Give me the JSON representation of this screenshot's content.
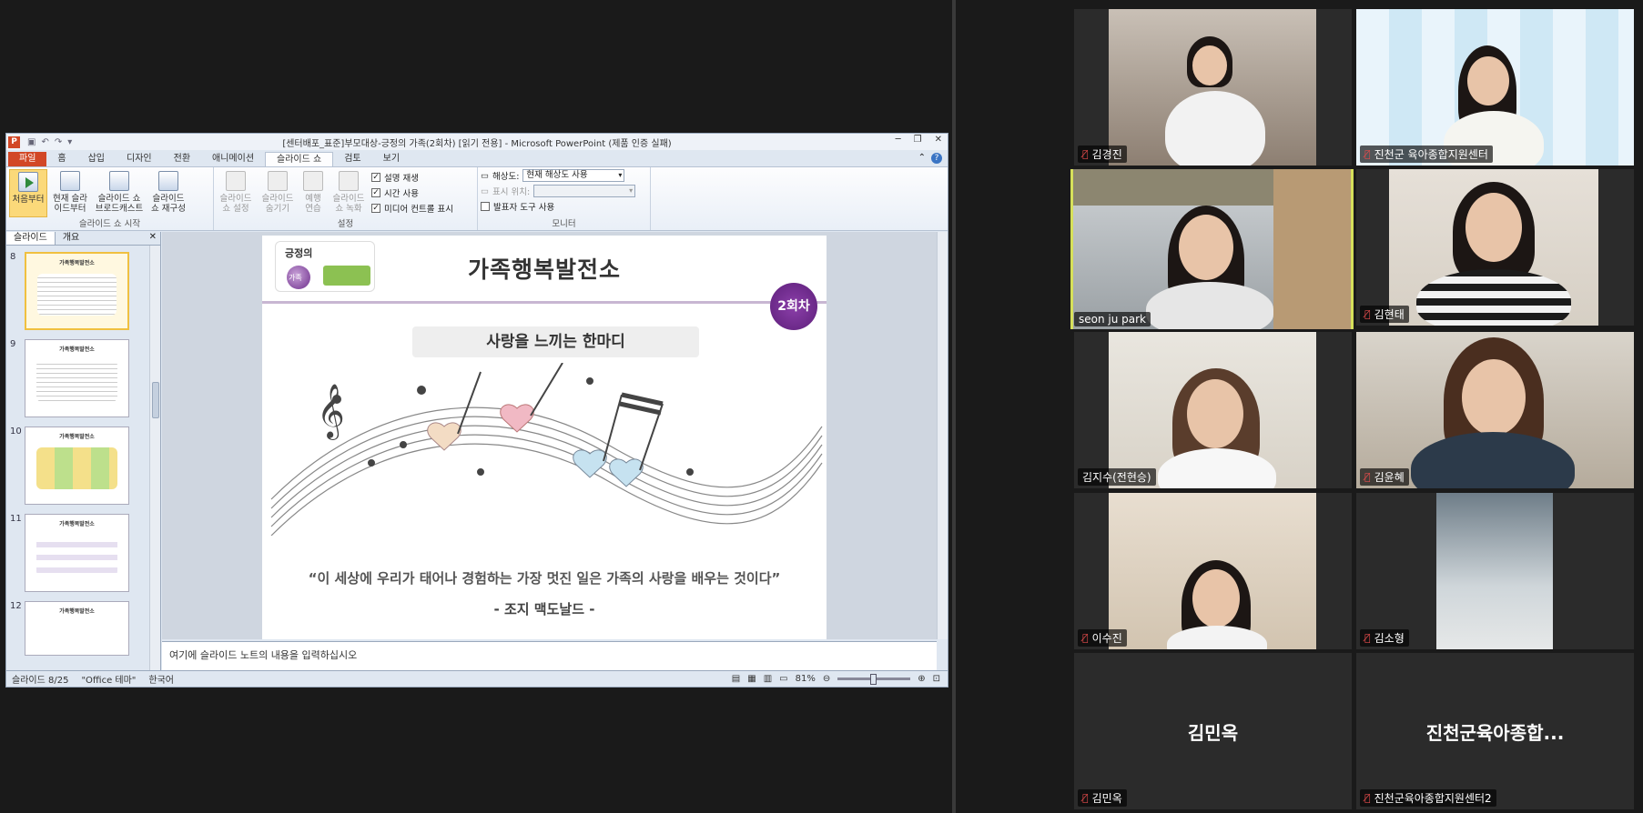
{
  "ppt": {
    "window_title": "[센터배포_표준]부모대상-긍정의 가족(2회차) [읽기 전용] - Microsoft PowerPoint (제품 인증 실패)",
    "tabs": [
      "파일",
      "홈",
      "삽입",
      "디자인",
      "전환",
      "애니메이션",
      "슬라이드 쇼",
      "검토",
      "보기"
    ],
    "active_tab": "슬라이드 쇼",
    "ribbon": {
      "group1_label": "슬라이드 쇼 시작",
      "btn_from_start": "처음부터",
      "btn_from_current": "현재 슬라이드부터",
      "btn_broadcast": "슬라이드 쇼 브로드캐스트",
      "btn_custom": "슬라이드 쇼 재구성",
      "group2_label": "설정",
      "btn_setup": "슬라이드 쇼 설정",
      "btn_hide": "슬라이드 숨기기",
      "btn_rehearse": "예행 연습",
      "btn_record": "슬라이드 쇼 녹화",
      "chk_narration": "설명 재생",
      "chk_timing": "시간 사용",
      "chk_media": "미디어 컨트롤 표시",
      "group3_label": "모니터",
      "resolution_label": "해상도:",
      "resolution_value": "현재 해상도 사용",
      "show_on_label": "표시 위치:",
      "show_on_value": "",
      "chk_presenter": "발표자 도구 사용"
    },
    "pane_tabs": [
      "슬라이드",
      "개요"
    ],
    "thumbnails": [
      {
        "num": "8",
        "title": "가족행복발전소"
      },
      {
        "num": "9",
        "title": "가족행복발전소"
      },
      {
        "num": "10",
        "title": "가족행복발전소"
      },
      {
        "num": "11",
        "title": "가족행복발전소"
      },
      {
        "num": "12",
        "title": "가족행복발전소"
      }
    ],
    "slide": {
      "logo_text": "긍정의",
      "logo_sub": "가족",
      "title": "가족행복발전소",
      "badge": "2회차",
      "subtitle": "사랑을 느끼는 한마디",
      "quote": "“이 세상에 우리가 태어나 경험하는 가장 멋진 일은 가족의 사랑을 배우는 것이다”",
      "author": "- 조지 맥도날드 -"
    },
    "notes_placeholder": "여기에 슬라이드 노트의 내용을 입력하십시오",
    "status": {
      "slide_count": "슬라이드 8/25",
      "theme": "\"Office 테마\"",
      "language": "한국어",
      "zoom": "81%"
    }
  },
  "participants": [
    {
      "name": "김경진",
      "muted": true,
      "video": true
    },
    {
      "name": "진천군 육아종합지원센터",
      "muted": true,
      "video": true
    },
    {
      "name": "seon ju park",
      "muted": false,
      "video": true,
      "active": true
    },
    {
      "name": "김현태",
      "muted": true,
      "video": true
    },
    {
      "name": "김지수(전현승)",
      "muted": false,
      "video": true
    },
    {
      "name": "김윤혜",
      "muted": true,
      "video": true
    },
    {
      "name": "이수진",
      "muted": true,
      "video": true
    },
    {
      "name": "김소형",
      "muted": true,
      "video": true
    },
    {
      "name": "김민옥",
      "muted": true,
      "video": false,
      "display": "김민옥"
    },
    {
      "name": "진천군육아종합지원센터2",
      "muted": true,
      "video": false,
      "display": "진천군육아종합..."
    }
  ],
  "colors": {
    "active_speaker": "#d6e05a",
    "mute_icon": "#e24b4b",
    "ppt_file_tab": "#d24726",
    "slide_badge": "#6d2d8c"
  }
}
